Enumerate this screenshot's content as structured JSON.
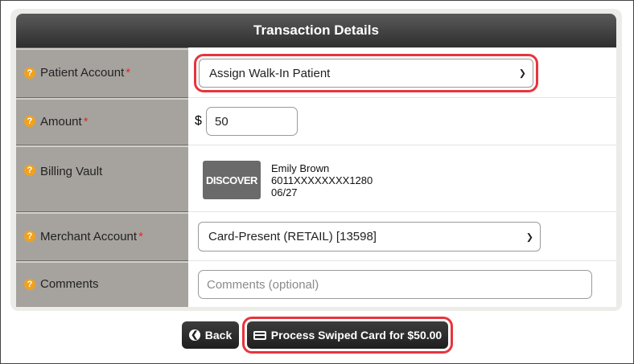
{
  "header": {
    "title": "Transaction Details"
  },
  "fields": {
    "patient_account": {
      "label": "Patient Account",
      "value": "Assign Walk-In Patient",
      "required": "*"
    },
    "amount": {
      "label": "Amount",
      "currency": "$",
      "value": "50",
      "required": "*"
    },
    "billing_vault": {
      "label": "Billing Vault",
      "card_brand": "DISCOVER",
      "card_holder": "Emily Brown",
      "card_number": "6011XXXXXXXX1280",
      "card_expiry": "06/27"
    },
    "merchant_account": {
      "label": "Merchant Account",
      "value": "Card-Present (RETAIL) [13598]",
      "required": "*"
    },
    "comments": {
      "label": "Comments",
      "placeholder": "Comments (optional)"
    }
  },
  "buttons": {
    "back": "Back",
    "process": "Process Swiped Card for $50.00"
  },
  "colors": {
    "highlight": "#e8343c",
    "help": "#f0a21e",
    "required": "#e02a2a"
  }
}
